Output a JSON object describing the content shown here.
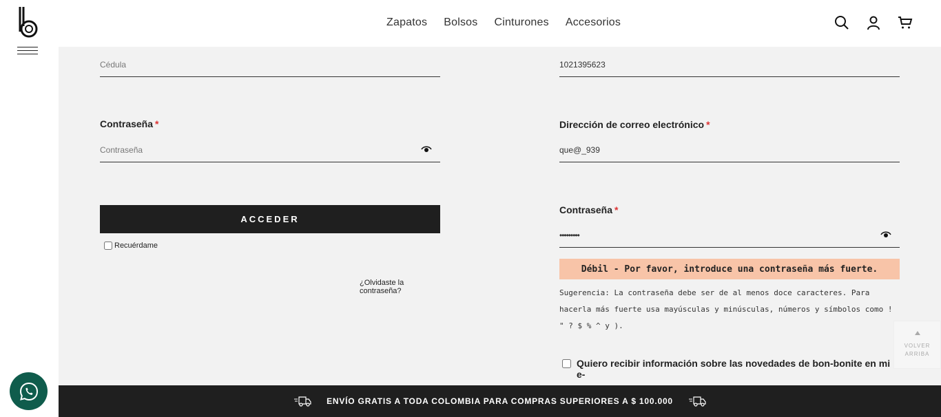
{
  "header": {
    "nav": [
      "Zapatos",
      "Bolsos",
      "Cinturones",
      "Accesorios"
    ],
    "icons": [
      "search-icon",
      "user-icon",
      "cart-icon"
    ]
  },
  "login": {
    "cedula_placeholder": "Cédula",
    "password_label": "Contraseña",
    "password_placeholder": "Contraseña",
    "submit_label": "ACCEDER",
    "remember_label": "Recuérdame",
    "forgot_label": "¿Olvidaste la contraseña?"
  },
  "register": {
    "cedula_value": "1021395623",
    "email_label": "Dirección de correo electrónico",
    "email_value": "que@_939",
    "password_label": "Contraseña",
    "password_value": "•••••••••",
    "strength_text": "Débil - Por favor, introduce una contraseña más fuerte.",
    "hint_text": "Sugerencia: La contraseña debe ser de al menos doce caracteres. Para hacerla más fuerte usa mayúsculas y minúsculas, números y símbolos como ! \" ? $ % ^ y ).",
    "newsletter_label": "Quiero recibir información sobre las novedades de bon-bonite en mi e-"
  },
  "required_mark": "*",
  "footer": {
    "shipping_text": "ENVÍO GRATIS A TODA COLOMBIA PARA COMPRAS SUPERIORES A $ 100.000"
  },
  "back_to_top": {
    "line1": "VOLVER",
    "line2": "ARRIBA"
  },
  "colors": {
    "strength_bg": "#f8c4a8",
    "whatsapp": "#0f5c4c",
    "dark": "#1f1f1f"
  }
}
